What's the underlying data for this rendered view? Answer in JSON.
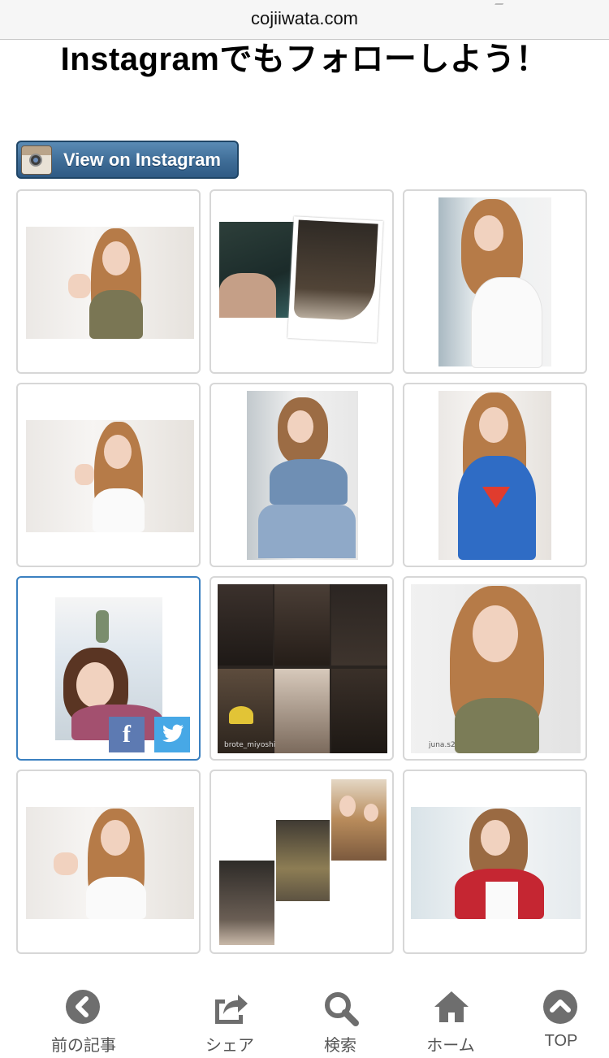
{
  "browser": {
    "url": "cojiiwata.com"
  },
  "page": {
    "heading": "Instagramでもフォローしよう！",
    "instagram_button_label": "View on Instagram"
  },
  "grid": {
    "tiles": [
      {
        "kind": "portrait-wide",
        "credit": ""
      },
      {
        "kind": "hair-closeups",
        "credit": ""
      },
      {
        "kind": "portrait-tall",
        "credit": ""
      },
      {
        "kind": "portrait-wide",
        "credit": ""
      },
      {
        "kind": "portrait-tall-denim",
        "credit": ""
      },
      {
        "kind": "portrait-tall-tshirt",
        "credit": ""
      },
      {
        "kind": "selfie",
        "credit": ""
      },
      {
        "kind": "collage",
        "credit": "brote_miyoshi"
      },
      {
        "kind": "portrait-close",
        "credit": "juna.s2"
      },
      {
        "kind": "portrait-wide",
        "credit": ""
      },
      {
        "kind": "hair-collage",
        "credit": ""
      },
      {
        "kind": "portrait-red-top",
        "credit": ""
      }
    ],
    "share": {
      "facebook": "f",
      "twitter": "twitter"
    }
  },
  "bottom_nav": {
    "items": [
      {
        "label": "前の記事",
        "icon": "chevron-left-icon"
      },
      {
        "label": "シェア",
        "icon": "share-icon"
      },
      {
        "label": "検索",
        "icon": "search-icon"
      },
      {
        "label": "ホーム",
        "icon": "home-icon"
      },
      {
        "label": "TOP",
        "icon": "chevron-up-icon"
      }
    ]
  },
  "colors": {
    "button_blue": "#3e6c96",
    "active_border": "#3b80c0",
    "nav_icon": "#6e6e6e",
    "hair": "#b67b48"
  }
}
